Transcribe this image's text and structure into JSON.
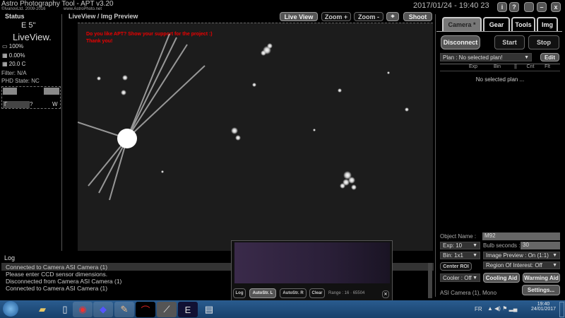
{
  "app": {
    "title": "Astro Photography Tool - APT v3.20",
    "copyright": "©IvanovLtd. 2009-2016",
    "website": "www.AstroPhoto.net",
    "datetime": "2017/01/24 - 19:40 23"
  },
  "window_buttons": {
    "info": "i",
    "help": "?",
    "minimize": "–",
    "close": "x"
  },
  "status": {
    "heading": "Status",
    "exposure": "E  5\"",
    "mode": "LiveView.",
    "progress": "100%",
    "guide": "0.00%",
    "temp": "20.0 C",
    "filter": "Filter: N/A",
    "phd": "PHD State: NC",
    "nav_left": "Г",
    "nav_mid": "?",
    "nav_right": "W"
  },
  "liveview": {
    "heading": "LiveView / Img Preview",
    "message_line1": "Do you like APT? Show your support for the project :)",
    "message_line2": "Thank you!"
  },
  "toolbar": {
    "live_view": "Live View",
    "zoom_in": "Zoom +",
    "zoom_out": "Zoom -",
    "crosshair": "⌖",
    "shoot": "Shoot"
  },
  "tabs": [
    {
      "label": "Camera *"
    },
    {
      "label": "Gear"
    },
    {
      "label": "Tools"
    },
    {
      "label": "Img"
    }
  ],
  "camera": {
    "disconnect": "Disconnect",
    "start": "Start",
    "stop": "Stop",
    "plan": "Plan : No selected plan!",
    "edit": "Edit",
    "columns": [
      "Exp",
      "Bin",
      "||",
      "Cnt",
      "Flt"
    ],
    "empty": "No selected plan ...",
    "object_name_label": "Object Name :",
    "object_name": "M92",
    "exp": "Exp: 10",
    "bulb_label": "Bulb seconds :",
    "bulb": "30",
    "bin": "Bin: 1x1",
    "image_preview": "Image Preview : On (1:1)",
    "center_roi": "Center ROI",
    "roi": "Region Of Interest: Off",
    "cooler": "Cooler : Off",
    "cooling_aid": "Cooling Aid",
    "warming_aid": "Warming Aid",
    "camera_info": "ASI Camera (1), Mono",
    "settings": "Settings..."
  },
  "log": {
    "heading": "Log",
    "lines": [
      "Connected to Camera ASI Camera (1)",
      "Please enter CCD sensor dimensions.",
      "Disconnected from Camera ASI Camera (1)",
      "Connected to Camera ASI Camera (1)"
    ]
  },
  "histogram": {
    "log": "Log",
    "autostr": "AutoStr. L",
    "autostr2": "AutoStr. R",
    "clear": "Clear",
    "range": "Range : 16 · 65504",
    "pin": "✕"
  },
  "taskbar": {
    "lang": "FR",
    "time": "19:40",
    "date": "24/01/2017"
  }
}
